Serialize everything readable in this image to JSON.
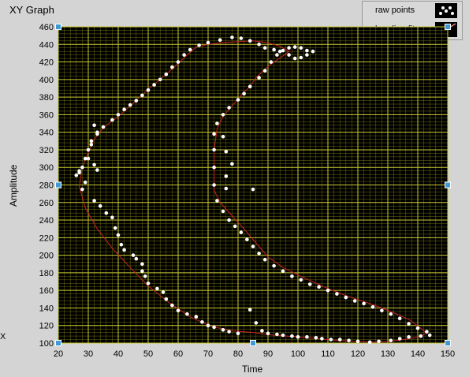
{
  "window": {
    "title": "XY Graph",
    "x_stub": "X"
  },
  "legend": {
    "items": [
      {
        "label": "raw points",
        "icon": "raw-points-icon"
      },
      {
        "label": "b-spline fit",
        "icon": "b-spline-fit-icon"
      }
    ]
  },
  "colors": {
    "plot_bg": "#000000",
    "grid": "#9a9a1a",
    "points": "#ffffff",
    "fit": "#cc2222",
    "panel": "#d4d4d4",
    "handle": "#3e9ad7"
  },
  "chart_data": {
    "type": "scatter",
    "title": "XY Graph",
    "xlabel": "Time",
    "ylabel": "Amplitude",
    "xlim": [
      20,
      150
    ],
    "ylim": [
      100,
      460
    ],
    "xticks": [
      20,
      30,
      40,
      50,
      60,
      70,
      80,
      90,
      100,
      110,
      120,
      130,
      140,
      150
    ],
    "yticks": [
      100,
      120,
      140,
      160,
      180,
      200,
      220,
      240,
      260,
      280,
      300,
      320,
      340,
      360,
      380,
      400,
      420,
      440,
      460
    ],
    "grid": true,
    "legend_position": "top-right",
    "series": [
      {
        "name": "raw points",
        "style": "markers",
        "points": [
          [
            26,
            291
          ],
          [
            27,
            296
          ],
          [
            28,
            275
          ],
          [
            29,
            283
          ],
          [
            30,
            310
          ],
          [
            31,
            326
          ],
          [
            32,
            348
          ],
          [
            33,
            340
          ],
          [
            32,
            303
          ],
          [
            33,
            297
          ],
          [
            32,
            262
          ],
          [
            34,
            256
          ],
          [
            36,
            248
          ],
          [
            38,
            243
          ],
          [
            39,
            231
          ],
          [
            40,
            223
          ],
          [
            41,
            212
          ],
          [
            42,
            206
          ],
          [
            45,
            200
          ],
          [
            46,
            196
          ],
          [
            48,
            190
          ],
          [
            48,
            182
          ],
          [
            49,
            176
          ],
          [
            50,
            168
          ],
          [
            53,
            162
          ],
          [
            55,
            158
          ],
          [
            56,
            150
          ],
          [
            58,
            143
          ],
          [
            60,
            137
          ],
          [
            63,
            133
          ],
          [
            66,
            130
          ],
          [
            68,
            124
          ],
          [
            70,
            120
          ],
          [
            72,
            118
          ],
          [
            75,
            115
          ],
          [
            77,
            113
          ],
          [
            80,
            111
          ],
          [
            84,
            138
          ],
          [
            86,
            123
          ],
          [
            88,
            114
          ],
          [
            90,
            111
          ],
          [
            93,
            110
          ],
          [
            95,
            109
          ],
          [
            98,
            108
          ],
          [
            100,
            107
          ],
          [
            103,
            107
          ],
          [
            106,
            106
          ],
          [
            108,
            105
          ],
          [
            111,
            104
          ],
          [
            114,
            104
          ],
          [
            117,
            103
          ],
          [
            120,
            102
          ],
          [
            124,
            101
          ],
          [
            127,
            102
          ],
          [
            131,
            103
          ],
          [
            134,
            105
          ],
          [
            137,
            107
          ],
          [
            141,
            108
          ],
          [
            144,
            109
          ],
          [
            143,
            113
          ],
          [
            140,
            117
          ],
          [
            137,
            122
          ],
          [
            134,
            128
          ],
          [
            131,
            133
          ],
          [
            128,
            137
          ],
          [
            125,
            141
          ],
          [
            122,
            145
          ],
          [
            119,
            148
          ],
          [
            116,
            152
          ],
          [
            113,
            156
          ],
          [
            110,
            160
          ],
          [
            107,
            164
          ],
          [
            104,
            167
          ],
          [
            101,
            172
          ],
          [
            98,
            176
          ],
          [
            95,
            182
          ],
          [
            92,
            188
          ],
          [
            89,
            195
          ],
          [
            87,
            202
          ],
          [
            85,
            210
          ],
          [
            83,
            218
          ],
          [
            81,
            226
          ],
          [
            79,
            233
          ],
          [
            77,
            240
          ],
          [
            75,
            250
          ],
          [
            73,
            262
          ],
          [
            72,
            280
          ],
          [
            72,
            300
          ],
          [
            72,
            320
          ],
          [
            72,
            338
          ],
          [
            73,
            350
          ],
          [
            75,
            360
          ],
          [
            77,
            368
          ],
          [
            80,
            377
          ],
          [
            82,
            384
          ],
          [
            84,
            392
          ],
          [
            87,
            402
          ],
          [
            89,
            410
          ],
          [
            91,
            420
          ],
          [
            93,
            428
          ],
          [
            95,
            433
          ],
          [
            97,
            436
          ],
          [
            99,
            437
          ],
          [
            101,
            436
          ],
          [
            103,
            433
          ],
          [
            105,
            432
          ],
          [
            103,
            428
          ],
          [
            101,
            425
          ],
          [
            99,
            424
          ],
          [
            97,
            428
          ],
          [
            94,
            432
          ],
          [
            92,
            434
          ],
          [
            89,
            436
          ],
          [
            87,
            440
          ],
          [
            84,
            444
          ],
          [
            81,
            447
          ],
          [
            78,
            448
          ],
          [
            74,
            445
          ],
          [
            70,
            442
          ],
          [
            67,
            439
          ],
          [
            64,
            434
          ],
          [
            62,
            428
          ],
          [
            60,
            420
          ],
          [
            58,
            414
          ],
          [
            56,
            406
          ],
          [
            54,
            400
          ],
          [
            52,
            394
          ],
          [
            50,
            388
          ],
          [
            48,
            382
          ],
          [
            46,
            376
          ],
          [
            44,
            371
          ],
          [
            42,
            366
          ],
          [
            40,
            360
          ],
          [
            38,
            354
          ],
          [
            35,
            346
          ],
          [
            33,
            338
          ],
          [
            31,
            330
          ],
          [
            30,
            320
          ],
          [
            29,
            310
          ],
          [
            28,
            300
          ],
          [
            27,
            294
          ],
          [
            85,
            275
          ],
          [
            75,
            335
          ],
          [
            76,
            318
          ],
          [
            78,
            304
          ],
          [
            76,
            290
          ],
          [
            76,
            276
          ]
        ]
      },
      {
        "name": "b-spline fit",
        "style": "line",
        "points": [
          [
            28,
            300
          ],
          [
            30,
            317
          ],
          [
            32,
            332
          ],
          [
            35,
            345
          ],
          [
            40,
            358
          ],
          [
            45,
            373
          ],
          [
            50,
            389
          ],
          [
            55,
            403
          ],
          [
            60,
            418
          ],
          [
            63,
            428
          ],
          [
            66,
            437
          ],
          [
            70,
            440
          ],
          [
            75,
            442
          ],
          [
            80,
            443
          ],
          [
            85,
            444
          ],
          [
            90,
            442
          ],
          [
            94,
            438
          ],
          [
            97,
            432
          ],
          [
            95,
            427
          ],
          [
            92,
            420
          ],
          [
            89,
            412
          ],
          [
            86,
            402
          ],
          [
            84,
            392
          ],
          [
            81,
            382
          ],
          [
            78,
            370
          ],
          [
            75,
            358
          ],
          [
            73,
            344
          ],
          [
            72,
            320
          ],
          [
            72,
            296
          ],
          [
            72,
            274
          ],
          [
            74,
            260
          ],
          [
            78,
            245
          ],
          [
            82,
            230
          ],
          [
            86,
            214
          ],
          [
            90,
            198
          ],
          [
            95,
            186
          ],
          [
            101,
            176
          ],
          [
            108,
            165
          ],
          [
            116,
            154
          ],
          [
            124,
            145
          ],
          [
            131,
            136
          ],
          [
            137,
            127
          ],
          [
            141,
            117
          ],
          [
            143,
            111
          ],
          [
            139,
            106
          ],
          [
            133,
            103
          ],
          [
            126,
            101
          ],
          [
            118,
            102
          ],
          [
            110,
            104
          ],
          [
            100,
            107
          ],
          [
            92,
            109
          ],
          [
            85,
            112
          ],
          [
            78,
            114
          ],
          [
            71,
            119
          ],
          [
            64,
            130
          ],
          [
            57,
            146
          ],
          [
            50,
            165
          ],
          [
            44,
            186
          ],
          [
            38,
            208
          ],
          [
            33,
            230
          ],
          [
            29,
            254
          ],
          [
            27,
            278
          ],
          [
            28,
            300
          ]
        ]
      }
    ]
  }
}
